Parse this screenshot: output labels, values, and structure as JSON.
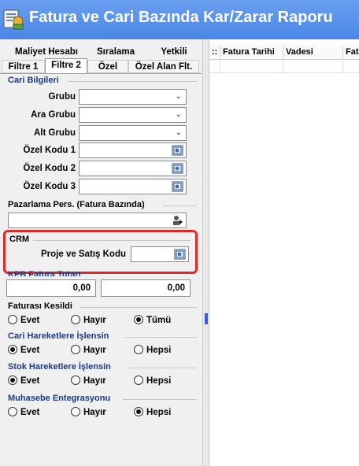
{
  "window": {
    "title": "Fatura ve Cari Bazında Kar/Zarar Raporu"
  },
  "tabs": {
    "upper": [
      "Maliyet Hesabı",
      "Sıralama",
      "Yetkili"
    ],
    "lower": [
      "Filtre 1",
      "Filtre 2",
      "Özel",
      "Özel Alan Flt."
    ],
    "active": "Filtre 2"
  },
  "cari_bilgileri": {
    "title": "Cari Bilgileri",
    "fields": [
      {
        "label": "Grubu",
        "value": ""
      },
      {
        "label": "Ara Grubu",
        "value": ""
      },
      {
        "label": "Alt Grubu",
        "value": ""
      },
      {
        "label": "Özel Kodu 1",
        "value": ""
      },
      {
        "label": "Özel Kodu 2",
        "value": ""
      },
      {
        "label": "Özel Kodu 3",
        "value": ""
      }
    ]
  },
  "pazarlama": {
    "title": "Pazarlama Pers. (Fatura Bazında)",
    "value": ""
  },
  "crm": {
    "title": "CRM",
    "label": "Proje ve Satış Kodu",
    "value": ""
  },
  "kpb": {
    "title": "KPB Fatura Tutarı",
    "from": "0,00",
    "to": "0,00"
  },
  "radio_groups": [
    {
      "title": "Faturası Kesildi",
      "options": [
        "Evet",
        "Hayır",
        "Tümü"
      ],
      "selected": "Tümü"
    },
    {
      "title": "Cari Hareketlere İşlensin",
      "options": [
        "Evet",
        "Hayır",
        "Hepsi"
      ],
      "selected": "Evet"
    },
    {
      "title": "Stok Hareketlere İşlensin",
      "options": [
        "Evet",
        "Hayır",
        "Hepsi"
      ],
      "selected": "Evet"
    },
    {
      "title": "Muhasebe Entegrasyonu",
      "options": [
        "Evet",
        "Hayır",
        "Hepsi"
      ],
      "selected": "Hepsi"
    }
  ],
  "grid": {
    "columns": [
      "::",
      "Fatura Tarihi",
      "Vadesi",
      "Fat"
    ]
  },
  "colors": {
    "titlebar": "#4a86e8",
    "highlight": "#e32626",
    "group_title": "#1a3a8c"
  },
  "icons": {
    "app": "report-app-icon",
    "lookup": "lookup-icon",
    "person_lookup": "person-lookup-icon",
    "combo": "chevron-down-icon"
  }
}
